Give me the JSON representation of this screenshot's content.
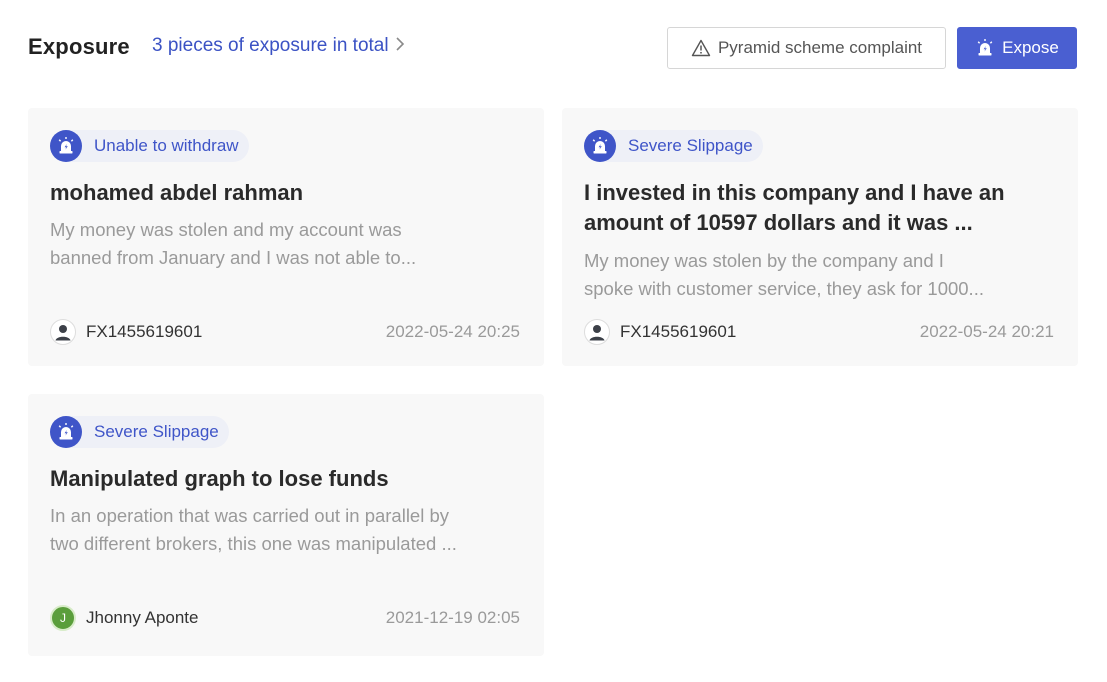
{
  "header": {
    "title": "Exposure",
    "count_link": "3 pieces of exposure in total",
    "complaint_button": "Pyramid scheme complaint",
    "expose_button": "Expose"
  },
  "colors": {
    "accent": "#3f55c8",
    "button_primary": "#4a5fd1",
    "card_bg": "#f8f8f8",
    "tag_bg": "#eef0f7",
    "muted_text": "#9a9a9a"
  },
  "cards": [
    {
      "tag": "Unable to withdraw",
      "tag_icon": "alarm-light-icon",
      "title": "mohamed abdel rahman",
      "desc_line1": "My money was stolen and my account was",
      "desc_line2": "banned from January and I was not able to...",
      "author": "FX1455619601",
      "avatar_icon": "user-silhouette-icon",
      "date": "2022-05-24 20:25"
    },
    {
      "tag": "Severe Slippage",
      "tag_icon": "alarm-light-icon",
      "title_line1": "I invested in this company and I have an",
      "title_line2": "amount of 10597 dollars and it was ...",
      "desc_line1": "My money was stolen by the company and I",
      "desc_line2": "spoke with customer service, they ask for 1000...",
      "author": "FX1455619601",
      "avatar_icon": "user-silhouette-icon",
      "date": "2022-05-24 20:21"
    },
    {
      "tag": "Severe Slippage",
      "tag_icon": "alarm-light-icon",
      "title": "Manipulated graph to lose funds",
      "desc_line1": "In an operation that was carried out in parallel by",
      "desc_line2": "two different brokers, this one was manipulated ...",
      "author": "Jhonny Aponte",
      "avatar_letter": "J",
      "date": "2021-12-19 02:05"
    }
  ]
}
